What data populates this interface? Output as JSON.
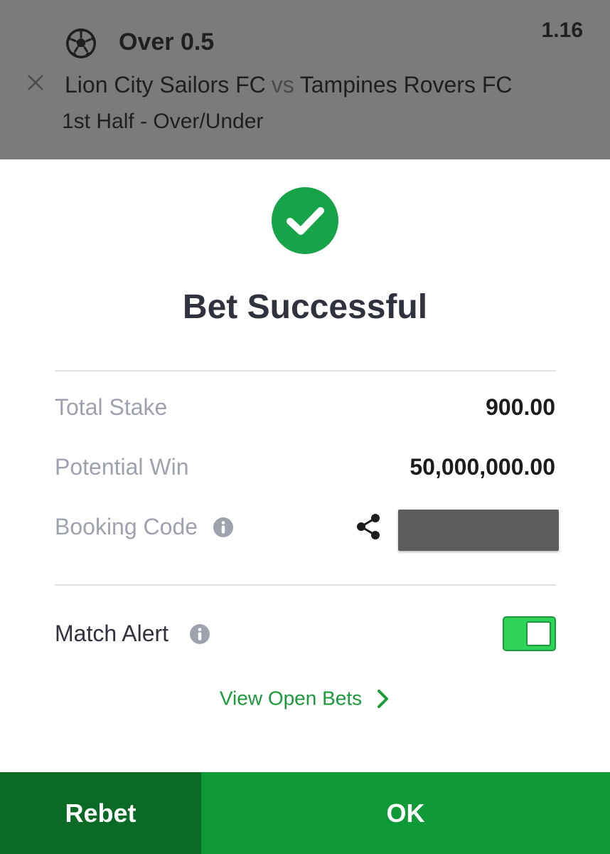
{
  "bet_slip": {
    "selection": "Over 0.5",
    "odds": "1.16",
    "home_team": "Lion City Sailors FC",
    "vs_label": "vs",
    "away_team": "Tampines Rovers FC",
    "market": "1st Half - Over/Under",
    "sport_icon": "soccer-ball-icon",
    "remove_icon": "close-icon"
  },
  "dialog": {
    "status_icon": "check-circle-icon",
    "title": "Bet Successful",
    "total_stake_label": "Total Stake",
    "total_stake_value": "900.00",
    "potential_win_label": "Potential Win",
    "potential_win_value": "50,000,000.00",
    "booking_code_label": "Booking Code",
    "booking_code_value": "",
    "match_alert_label": "Match Alert",
    "match_alert_enabled": true,
    "view_open_bets_label": "View Open Bets"
  },
  "actions": {
    "rebet_label": "Rebet",
    "ok_label": "OK"
  },
  "colors": {
    "brand_green": "#0f9a37",
    "dark_green": "#0b6b26",
    "overlay_gray": "#7b7b7b",
    "toggle_green": "#2fd35a"
  }
}
